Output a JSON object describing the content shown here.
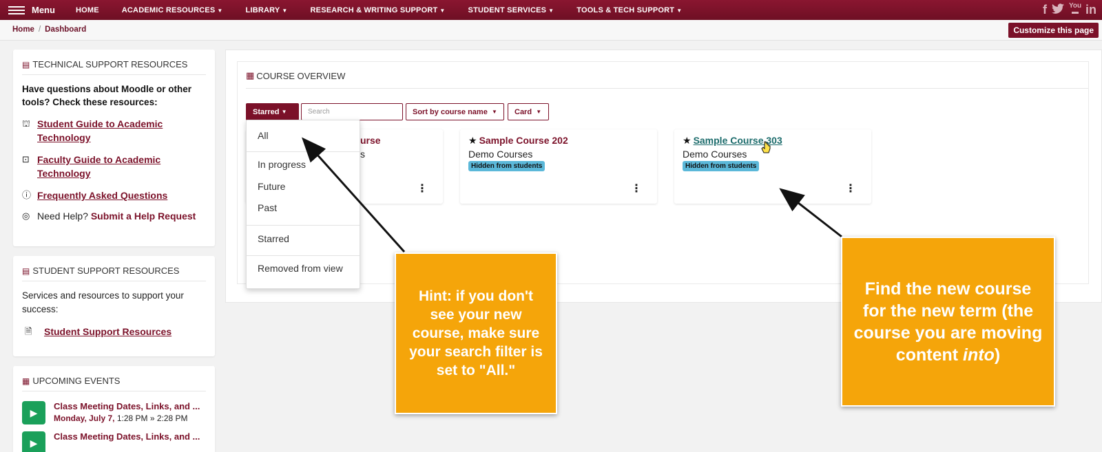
{
  "nav": {
    "menu_label": "Menu",
    "items": [
      {
        "label": "HOME",
        "dropdown": false
      },
      {
        "label": "ACADEMIC RESOURCES",
        "dropdown": true
      },
      {
        "label": "LIBRARY",
        "dropdown": true
      },
      {
        "label": "RESEARCH & WRITING SUPPORT",
        "dropdown": true
      },
      {
        "label": "STUDENT SERVICES",
        "dropdown": true
      },
      {
        "label": "TOOLS & TECH SUPPORT",
        "dropdown": true
      }
    ],
    "social_icons": [
      "facebook-icon",
      "twitter-icon",
      "youtube-icon",
      "linkedin-icon"
    ]
  },
  "breadcrumb": {
    "home": "Home",
    "separator": "/",
    "current": "Dashboard"
  },
  "customize_label": "Customize this page",
  "tech_support": {
    "title": "TECHNICAL SUPPORT RESOURCES",
    "intro": "Have questions about Moodle or other tools? Check these resources:",
    "links": [
      {
        "label": "Student Guide to Academic Technology",
        "icon": "student-guide-icon"
      },
      {
        "label": "Faculty Guide to Academic Technology",
        "icon": "faculty-guide-icon"
      },
      {
        "label": "Frequently Asked Questions",
        "icon": "info-icon"
      }
    ],
    "help_prefix": "Need Help?",
    "help_link": "Submit a Help Request"
  },
  "student_support": {
    "title": "STUDENT SUPPORT RESOURCES",
    "text": "Services and resources to support your success:",
    "link": "Student Support Resources"
  },
  "events": {
    "title": "UPCOMING EVENTS",
    "items": [
      {
        "title": "Class Meeting Dates, Links, and ...",
        "date": "Monday, July 7,",
        "time": "1:28 PM » 2:28 PM"
      },
      {
        "title": "Class Meeting Dates, Links, and ..."
      }
    ]
  },
  "course_overview": {
    "title": "COURSE OVERVIEW",
    "filter_label": "Starred",
    "search_placeholder": "Search",
    "sort_label": "Sort by course name",
    "view_label": "Card",
    "dropdown_items": [
      "All",
      "In progress",
      "Future",
      "Past",
      "Starred",
      "Removed from view"
    ],
    "courses": [
      {
        "title_partial": "urse",
        "category_partial": "s"
      },
      {
        "name": "Sample Course 202",
        "category": "Demo Courses",
        "badge": "Hidden from students"
      },
      {
        "name": "Sample Course 303",
        "category": "Demo Courses",
        "badge": "Hidden from students"
      }
    ]
  },
  "hints": {
    "hint1": "Hint: if you don't see your new course, make sure your search filter is set to \"All.\"",
    "hint2_main": "Find the new course for the new term (the course you are moving content",
    "hint2_em": "into",
    "hint2_end": ")"
  },
  "colors": {
    "brand": "#7b1129",
    "hint": "#f5a50a",
    "badge": "#5bb8d9",
    "event": "#1aa05a"
  }
}
